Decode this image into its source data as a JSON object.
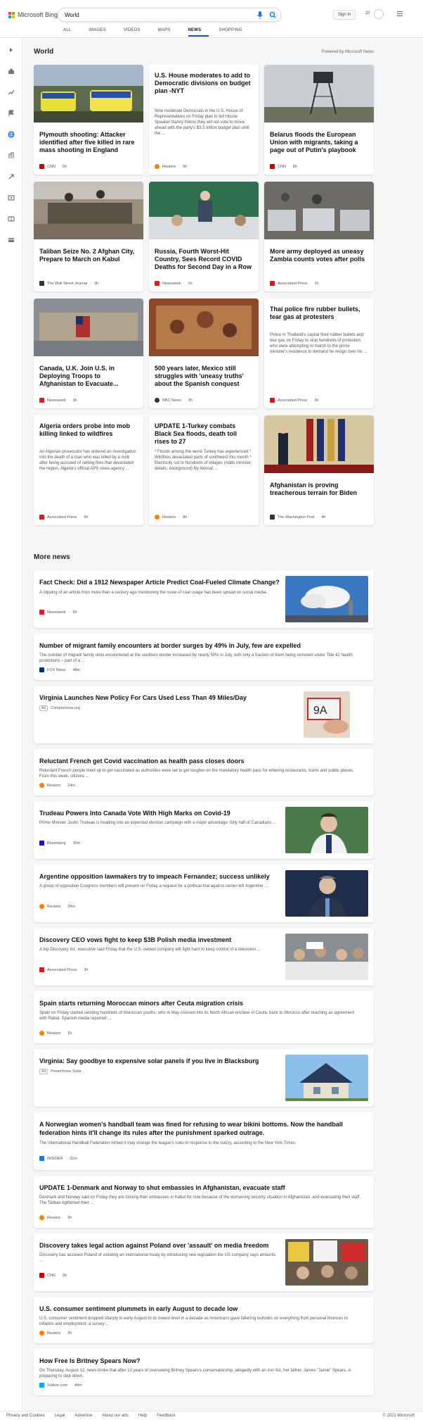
{
  "brand": {
    "name": "Microsoft Bing"
  },
  "search": {
    "query": "World"
  },
  "header": {
    "signin": "Sign in",
    "points": "20"
  },
  "tabs": [
    {
      "label": "ALL"
    },
    {
      "label": "IMAGES"
    },
    {
      "label": "VIDEOS"
    },
    {
      "label": "MAPS"
    },
    {
      "label": "NEWS",
      "active": true
    },
    {
      "label": "SHOPPING"
    }
  ],
  "section": {
    "title": "World",
    "powered": "Powered by Microsoft News"
  },
  "cards": [
    {
      "title": "Plymouth shooting: Attacker identified after five killed in rare mass shooting in England",
      "source": "CNN",
      "time": "5h",
      "source_color": "#cc0000"
    },
    {
      "title": "U.S. House moderates to add to Democratic divisions on budget plan -NYT",
      "desc": "Nine moderate Democrats in the U.S. House of Representatives on Friday plan to tell House Speaker Nancy Pelosi they will not vote to move ahead with the party's $3.5 trillion budget plan until the ...",
      "source": "Reuters",
      "time": "5h",
      "source_color": "#ff8000"
    },
    {
      "title": "Belarus floods the European Union with migrants, taking a page out of Putin's playbook",
      "source": "CNN",
      "time": "8h",
      "source_color": "#cc0000"
    },
    {
      "title": "Taliban Seize No. 2 Afghan City, Prepare to March on Kabul",
      "source": "The Wall Street Journal",
      "time": "3h",
      "source_color": "#333333"
    },
    {
      "title": "Russia, Fourth Worst-Hit Country, Sees Record COVID Deaths for Second Day in a Row",
      "source": "Newsweek",
      "time": "1h",
      "source_color": "#e31b23"
    },
    {
      "title": "More army deployed as uneasy Zambia counts votes after polls",
      "source": "Associated Press",
      "time": "1h",
      "source_color": "#d71920"
    },
    {
      "title": "Canada, U.K. Join U.S. in Deploying Troops to Afghanistan to Evacuate...",
      "source": "Newsweek",
      "time": "3h",
      "source_color": "#e31b23"
    },
    {
      "title": "500 years later, Mexico still struggles with 'uneasy truths' about the Spanish conquest",
      "source": "NBC News",
      "time": "3h",
      "source_color": "#333333"
    },
    {
      "title": "Thai police fire rubber bullets, tear gas at protesters",
      "desc": "Police in Thailand's capital fired rubber bullets and tear gas on Friday to stop hundreds of protesters who were attempting to march to the prime minister's residence to demand he resign over his ...",
      "source": "Associated Press",
      "time": "3h",
      "source_color": "#d71920"
    },
    {
      "title": "Algeria orders probe into mob killing linked to wildfires",
      "desc": "An Algerian prosecutor has ordered an investigation into the death of a man who was killed by a mob after being accused of setting fires that devastated the region, Algeria's official APS news agency ...",
      "source": "Associated Press",
      "time": "6h",
      "source_color": "#d71920"
    },
    {
      "title": "UPDATE 1-Turkey combats Black Sea floods, death toll rises to 27",
      "desc": "* Floods among the worst Turkey has experienced * Wildfires devastated parts of southwest this month * Electricity cut to hundreds of villages (Adds minister, details, background) By Nevzat ...",
      "source": "Reuters",
      "time": "8h",
      "source_color": "#ff8000"
    },
    {
      "title": "Afghanistan is proving treacherous terrain for Biden",
      "source": "The Washington Post",
      "time": "4h",
      "source_color": "#333333"
    }
  ],
  "more": {
    "title": "More news"
  },
  "news": [
    {
      "title": "Fact Check: Did a 1912 Newspaper Article Predict Coal-Fueled Climate Change?",
      "desc": "A clipping of an article from more than a century ago mentioning the issue of coal usage has been spread on social media.",
      "source": "Newsweek",
      "time": "6h",
      "source_color": "#e31b23"
    },
    {
      "title": "Number of migrant family encounters at border surges by 49% in July, few are expelled",
      "desc": "The number of migrant family units encountered at the southern border increased by nearly 50% in July, with only a fraction of them being removed under Title 42 health protections – part of a ...",
      "source": "FOX News",
      "time": "48m",
      "source_color": "#003366"
    },
    {
      "title": "Virginia Launches New Policy For Cars Used Less Than 49 Miles/Day",
      "ad": "Ad",
      "source": "Comparisons.org"
    },
    {
      "title": "Reluctant French get Covid vaccination as health pass closes doors",
      "desc": "Reluctant French people lined up to get vaccinated as authorities were set to get tougher on the mandatory health pass for entering restaurants, trains and public places. From this week, citizens ...",
      "source": "Reuters",
      "time": "24m",
      "source_color": "#ff8000"
    },
    {
      "title": "Trudeau Powers Into Canada Vote With High Marks on Covid-19",
      "desc": "Prime Minister Justin Trudeau is heading into an expected election campaign with a major advantage: fully half of Canadians ...",
      "source": "Bloomberg",
      "time": "30m",
      "source_color": "#3300cc"
    },
    {
      "title": "Argentine opposition lawmakers try to impeach Fernandez; success unlikely",
      "desc": "A group of opposition Congress members will present on Friday a request for a political trial against center-left Argentine ...",
      "source": "Reuters",
      "time": "39m",
      "source_color": "#ff8000"
    },
    {
      "title": "Discovery CEO vows fight to keep $3B Polish media investment",
      "desc": "A top Discovery Inc. executive said Friday that the U.S.-owned company will fight hard to keep control of a television ...",
      "source": "Associated Press",
      "time": "3h",
      "source_color": "#d71920"
    },
    {
      "title": "Spain starts returning Moroccan minors after Ceuta migration crisis",
      "desc": "Spain on Friday started sending hundreds of Moroccan youths, who in May crossed into its North African enclave of Ceuta, back to Morocco after reaching an agreement with Rabat, Spanish media reported; ...",
      "source": "Reuters",
      "time": "1h",
      "source_color": "#ff8000"
    },
    {
      "title": "Virginia: Say goodbye to expensive solar panels if you live in Blacksburg",
      "ad": "Ad",
      "source": "Powerhome Solar"
    },
    {
      "title": "A Norwegian women's handball team was fined for refusing to wear bikini bottoms. Now the handball federation hints it'll change its rules after the punishment sparked outrage.",
      "desc": "The International Handball Federation hinted it may change the league's rules in response to the outcry, according to the New York Times.",
      "source": "INSIDER",
      "time": "31m",
      "source_color": "#1a73e8"
    },
    {
      "title": "UPDATE 1-Denmark and Norway to shut embassies in Afghanistan, evacuate staff",
      "desc": "Denmark and Norway said on Friday they are closing their embassies in Kabul for now because of the worsening security situation in Afghanistan, and evacuating their staff. The Taliban tightened their ...",
      "source": "Reuters",
      "time": "2h",
      "source_color": "#ff8000"
    },
    {
      "title": "Discovery takes legal action against Poland over 'assault' on media freedom",
      "desc": "Discovery has accused Poland of violating an international treaty by introducing new legislation the US company says amounts ...",
      "source": "CNN",
      "time": "3h",
      "source_color": "#cc0000"
    },
    {
      "title": "U.S. consumer sentiment plummets in early August to decade low",
      "desc": "U.S. consumer sentiment dropped sharply in early August to its lowest level in a decade as Americans gave faltering outlooks on everything from personal finances to inflation and employment, a survey ...",
      "source": "Reuters",
      "time": "2h",
      "source_color": "#ff8000"
    },
    {
      "title": "How Free Is Britney Spears Now?",
      "desc": "On Thursday, August 12, news broke that after 13 years of overseeing Britney Spears's conservatorship, allegedly with an iron fist, her father, James \"Jamie\" Spears, is preparing to step down.",
      "source": "Vulture.com",
      "time": "48m",
      "source_color": "#00aaff"
    }
  ],
  "footer": {
    "links": [
      "Privacy and Cookies",
      "Legal",
      "Advertise",
      "About our ads",
      "Help",
      "Feedback"
    ],
    "copyright": "© 2021 Microsoft"
  }
}
